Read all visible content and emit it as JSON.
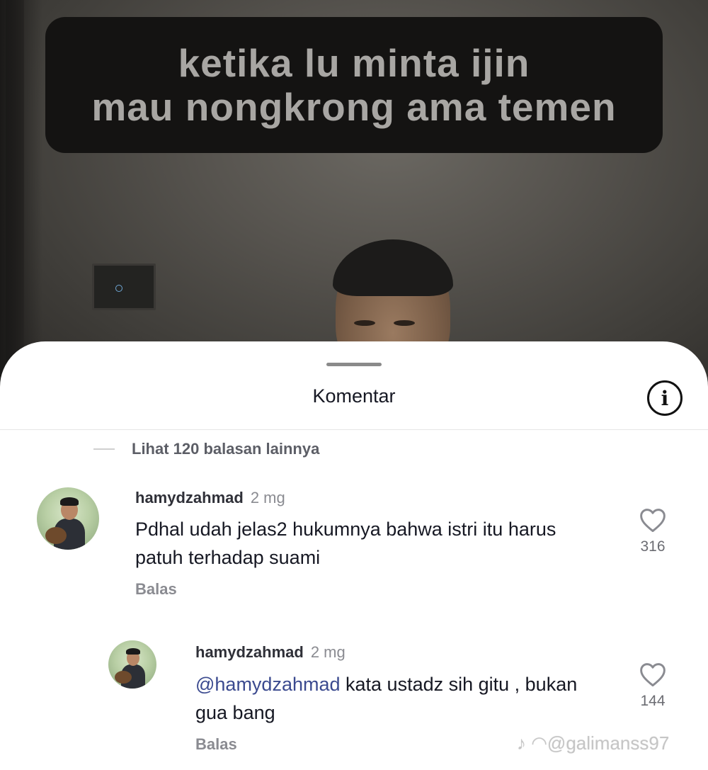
{
  "video": {
    "caption_line1": "ketika lu minta ijin",
    "caption_line2": "mau nongkrong ama temen"
  },
  "sheet": {
    "title": "Komentar",
    "info_icon": "info-icon",
    "more_replies": "Lihat 120 balasan lainnya"
  },
  "comments": [
    {
      "username": "hamydzahmad",
      "time": "2 mg",
      "text": "Pdhal udah jelas2 hukumnya bahwa istri itu harus patuh terhadap suami",
      "reply_label": "Balas",
      "likes": "316"
    },
    {
      "username": "hamydzahmad",
      "time": "2 mg",
      "mention": "@hamydzahmad",
      "text": " kata ustadz sih gitu , bukan gua bang",
      "reply_label": "Balas",
      "likes": "144"
    }
  ],
  "watermark": "@galimanss97",
  "colors": {
    "accent_mention": "#3b4a8f",
    "text_primary": "#161823",
    "text_secondary": "#8a8b91"
  }
}
